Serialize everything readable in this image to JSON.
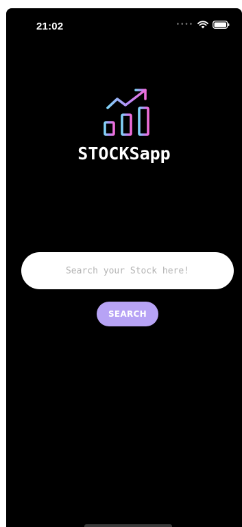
{
  "status_bar": {
    "time": "21:02",
    "signal": "••••",
    "wifi_icon": "wifi-icon",
    "battery_icon": "battery-icon"
  },
  "app": {
    "title": "STOCKSapp",
    "logo_icon": "bar-chart-trend-up-icon",
    "gradient": [
      "#7fd3f7",
      "#b98cf7",
      "#f06bd8"
    ]
  },
  "search": {
    "placeholder": "Search your Stock here!",
    "value": "",
    "button_label": "SEARCH"
  },
  "colors": {
    "background": "#000000",
    "button": "#b7a3f5",
    "input_bg": "#ffffff"
  }
}
